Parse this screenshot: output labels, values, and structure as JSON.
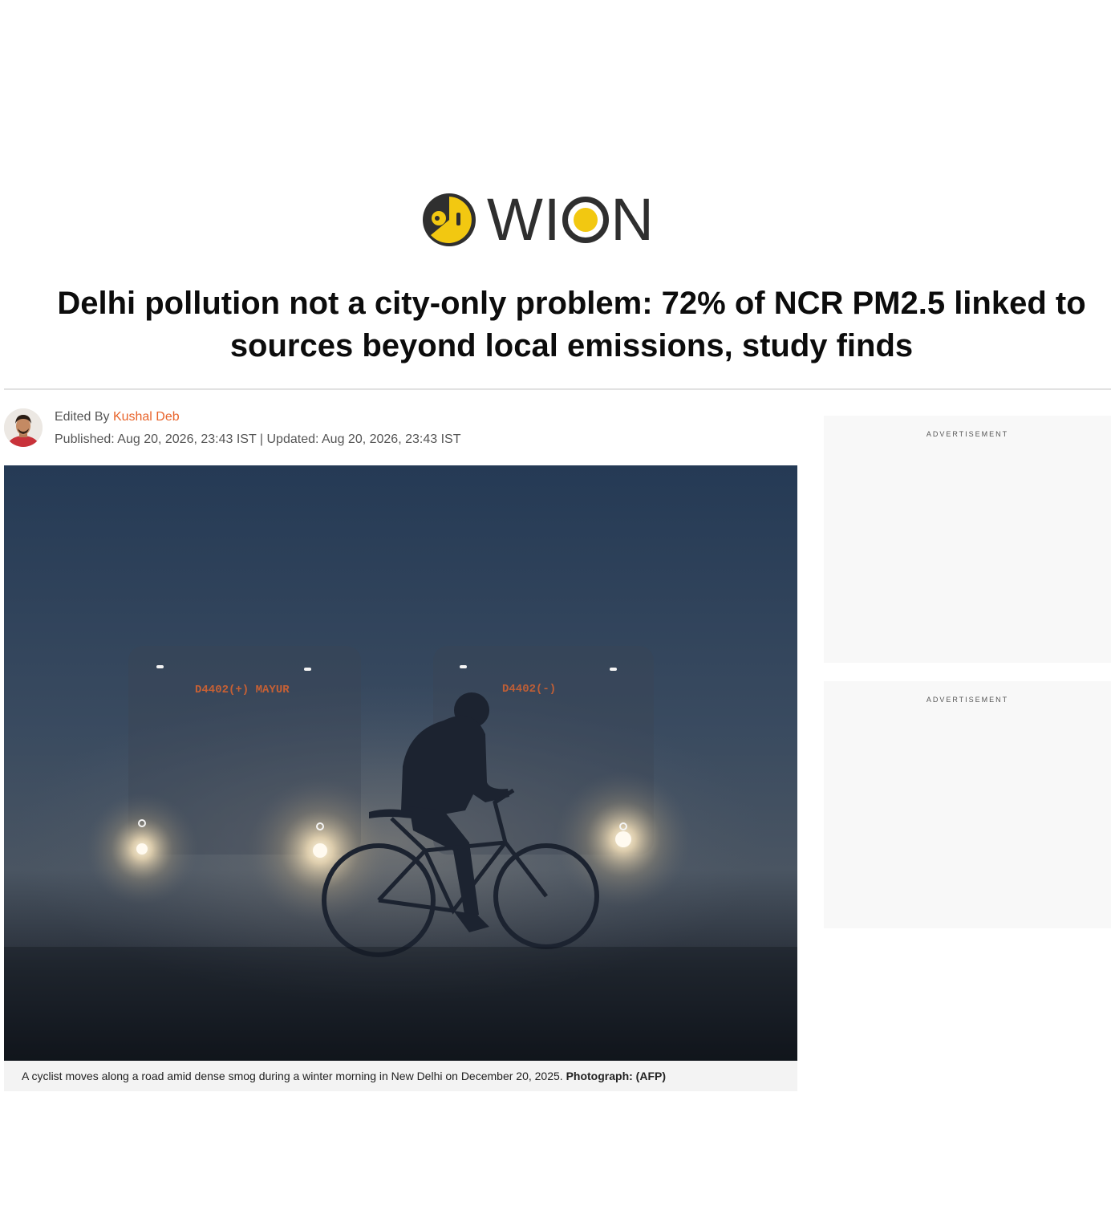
{
  "brand": {
    "name": "WION",
    "logo_icon": "wion-logo-icon",
    "colors": {
      "accent_yellow": "#f2c811",
      "dark": "#2f2f2f",
      "author_link": "#e8632a"
    }
  },
  "article": {
    "headline": "Delhi pollution not a city-only problem: 72% of NCR PM2.5 linked to sources beyond local emissions, study finds",
    "byline": {
      "edited_by_label": "Edited By",
      "author": "Kushal Deb",
      "dates": "Published: Aug 20, 2026, 23:43 IST | Updated: Aug 20, 2026, 23:43 IST"
    },
    "hero": {
      "image_icon": "smog-cyclist-photo",
      "bus_sign_left": "D4402(+) MAYUR",
      "bus_sign_right": "D4402(-)",
      "caption": "A cyclist moves along a road amid dense smog during a winter morning in New Delhi on December 20, 2025.",
      "credit": "Photograph: (AFP)"
    }
  },
  "sidebar": {
    "ads": [
      {
        "label": "ADVERTISEMENT"
      },
      {
        "label": "ADVERTISEMENT"
      }
    ]
  }
}
